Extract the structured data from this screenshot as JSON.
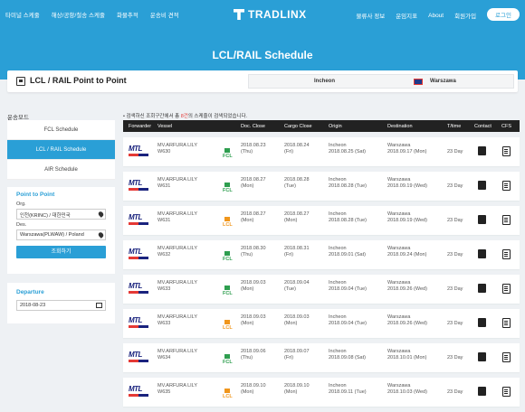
{
  "nav": {
    "left": [
      "타미널 스케줄",
      "해상/공항/철송 스케줄",
      "화물추적",
      "운송비 견적"
    ],
    "logo": "TRADLINX",
    "right": [
      "물류사 정보",
      "운임지표",
      "About",
      "회원가입"
    ],
    "login": "로그인"
  },
  "page_title": "LCL/RAIL Schedule",
  "title_bar": {
    "title": "LCL / RAIL Point to Point",
    "origin": "Incheon",
    "destination": "Warszawa"
  },
  "sidebar": {
    "mode_label": "운송모드",
    "modes": [
      "FCL Schedule",
      "LCL / RAIL Schedule",
      "AIR Schedule"
    ],
    "active_mode": 1,
    "p2p_title": "Point to Point",
    "orig_label": "Org.",
    "orig_value": "인천(KRINC) / 대한민국",
    "dest_label": "Des.",
    "dest_value": "Warszawa(PLWAW) / Poland",
    "search_label": "조회하기",
    "departure_title": "Departure",
    "departure_value": "2018-08-23"
  },
  "result": {
    "prefix": "검색하신 조회구간에서 총 ",
    "count": "8건",
    "suffix": "의 스케줄이 검색되었습니다."
  },
  "table": {
    "headers": [
      "Forwarder",
      "Vessel",
      "Doc. Close",
      "Cargo Close",
      "Origin",
      "Destination",
      "T/time",
      "Contact",
      "CFS"
    ],
    "rows": [
      {
        "forwarder": "MTL",
        "vessel": "MV.ARFURA LILY",
        "voyage": "W630",
        "type": "FCL",
        "doc_date": "2018.08.23",
        "doc_day": "(Thu)",
        "cargo_date": "2018.08.24",
        "cargo_day": "(Fri)",
        "origin": "Incheon",
        "origin_date": "2018.08.25 (Sat)",
        "dest": "Warszawa",
        "dest_date": "2018.09.17 (Mon)",
        "ttime": "23 Day"
      },
      {
        "forwarder": "MTL",
        "vessel": "MV.ARFURA LILY",
        "voyage": "W631",
        "type": "FCL",
        "doc_date": "2018.08.27",
        "doc_day": "(Mon)",
        "cargo_date": "2018.08.28",
        "cargo_day": "(Tue)",
        "origin": "Incheon",
        "origin_date": "2018.08.28 (Tue)",
        "dest": "Warszawa",
        "dest_date": "2018.09.19 (Wed)",
        "ttime": "23 Day"
      },
      {
        "forwarder": "MTL",
        "vessel": "MV.ARFURA LILY",
        "voyage": "W631",
        "type": "LCL",
        "doc_date": "2018.08.27",
        "doc_day": "(Mon)",
        "cargo_date": "2018.08.27",
        "cargo_day": "(Mon)",
        "origin": "Incheon",
        "origin_date": "2018.08.28 (Tue)",
        "dest": "Warszawa",
        "dest_date": "2018.09.19 (Wed)",
        "ttime": "23 Day"
      },
      {
        "forwarder": "MTL",
        "vessel": "MV.ARFURA LILY",
        "voyage": "W632",
        "type": "FCL",
        "doc_date": "2018.08.30",
        "doc_day": "(Thu)",
        "cargo_date": "2018.08.31",
        "cargo_day": "(Fri)",
        "origin": "Incheon",
        "origin_date": "2018.09.01 (Sat)",
        "dest": "Warszawa",
        "dest_date": "2018.09.24 (Mon)",
        "ttime": "23 Day"
      },
      {
        "forwarder": "MTL",
        "vessel": "MV.ARFURA LILY",
        "voyage": "W633",
        "type": "FCL",
        "doc_date": "2018.09.03",
        "doc_day": "(Mon)",
        "cargo_date": "2018.09.04",
        "cargo_day": "(Tue)",
        "origin": "Incheon",
        "origin_date": "2018.09.04 (Tue)",
        "dest": "Warszawa",
        "dest_date": "2018.09.26 (Wed)",
        "ttime": "23 Day"
      },
      {
        "forwarder": "MTL",
        "vessel": "MV.ARFURA LILY",
        "voyage": "W633",
        "type": "LCL",
        "doc_date": "2018.09.03",
        "doc_day": "(Mon)",
        "cargo_date": "2018.09.03",
        "cargo_day": "(Mon)",
        "origin": "Incheon",
        "origin_date": "2018.09.04 (Tue)",
        "dest": "Warszawa",
        "dest_date": "2018.09.26 (Wed)",
        "ttime": "23 Day"
      },
      {
        "forwarder": "MTL",
        "vessel": "MV.ARFURA LILY",
        "voyage": "W634",
        "type": "FCL",
        "doc_date": "2018.09.06",
        "doc_day": "(Thu)",
        "cargo_date": "2018.09.07",
        "cargo_day": "(Fri)",
        "origin": "Incheon",
        "origin_date": "2018.09.08 (Sat)",
        "dest": "Warszawa",
        "dest_date": "2018.10.01 (Mon)",
        "ttime": "23 Day"
      },
      {
        "forwarder": "MTL",
        "vessel": "MV.ARFURA LILY",
        "voyage": "W635",
        "type": "LCL",
        "doc_date": "2018.09.10",
        "doc_day": "(Mon)",
        "cargo_date": "2018.09.10",
        "cargo_day": "(Mon)",
        "origin": "Incheon",
        "origin_date": "2018.09.11 (Tue)",
        "dest": "Warszawa",
        "dest_date": "2018.10.03 (Wed)",
        "ttime": "23 Day"
      }
    ]
  },
  "colors": {
    "brand": "#2a9fd6",
    "fcl": "#2e9e4f",
    "lcl": "#f0961c",
    "header_row": "#222222"
  }
}
